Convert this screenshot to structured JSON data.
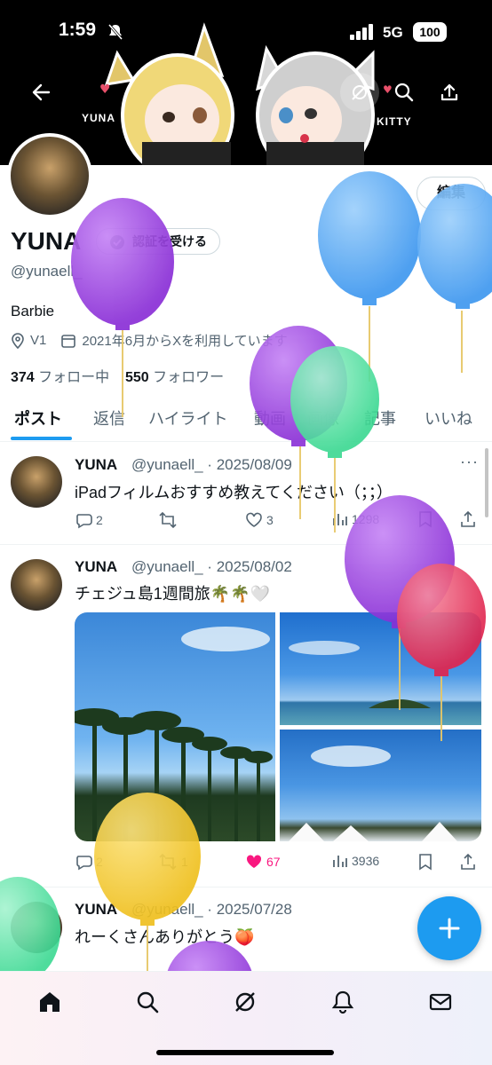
{
  "status_bar": {
    "time": "1:59",
    "network": "5G",
    "battery": "100"
  },
  "banner": {
    "label_left": "YUNA",
    "label_right": "KITTY"
  },
  "profile": {
    "edit_label": "編集",
    "display_name": "YUNA",
    "verify_label": "認証を受ける",
    "handle": "@yunaell_",
    "bio": "Barbie",
    "location": "V1",
    "joined": "2021年6月からXを利用しています",
    "following_count": "374",
    "following_label": "フォロー中",
    "followers_count": "550",
    "followers_label": "フォロワー"
  },
  "tabs": [
    {
      "label": "ポスト",
      "active": true
    },
    {
      "label": "返信"
    },
    {
      "label": "ハイライト"
    },
    {
      "label": "動画"
    },
    {
      "label": "画像"
    },
    {
      "label": "記事"
    },
    {
      "label": "いいね"
    }
  ],
  "posts": [
    {
      "name": "YUNA",
      "handle_date": "@yunaell_ · 2025/08/09",
      "text": "iPadフィルムおすすめ教えてください（；；）",
      "replies": "2",
      "reposts": "",
      "likes": "3",
      "views": "1298"
    },
    {
      "name": "YUNA",
      "handle_date": "@yunaell_ · 2025/08/02",
      "text": "チェジュ島1週間旅🌴🌴🤍",
      "replies": "2",
      "reposts": "1",
      "likes": "67",
      "views": "3936"
    },
    {
      "name": "YUNA",
      "handle_date": "@yunaell_ · 2025/07/28",
      "text": "れーくさんありがとう🍑"
    }
  ],
  "colors": {
    "accent": "#1d9bf0",
    "liked": "#f91880",
    "balloon_purple": "#9b3fe0",
    "balloon_blue": "#4ea6f5",
    "balloon_green": "#4fe0a0",
    "balloon_red": "#ea3a5e",
    "balloon_yellow": "#f2c92e"
  },
  "icons": {
    "back": "arrow-left-icon",
    "grok": "grok-icon",
    "search": "search-icon",
    "share": "share-icon",
    "verify": "verified-badge-icon",
    "location": "location-pin-icon",
    "calendar": "calendar-icon",
    "reply": "reply-icon",
    "repost": "repost-icon",
    "like": "heart-icon",
    "views": "views-icon",
    "bookmark": "bookmark-icon",
    "fab": "plus-icon"
  }
}
